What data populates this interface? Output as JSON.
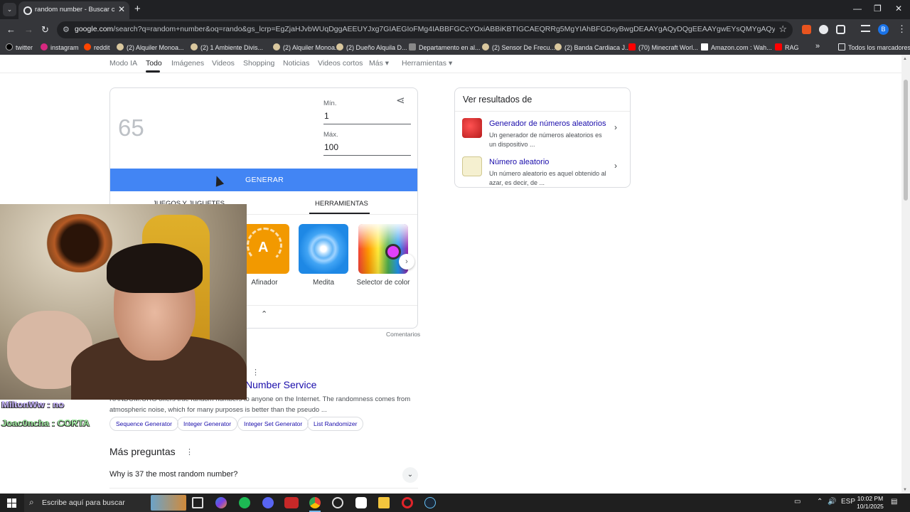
{
  "browser": {
    "tab_title": "random number - Buscar con Google",
    "url_host": "google.com",
    "url_rest": "/search?q=random+number&oq=rando&gs_lcrp=EgZjaHJvbWUqDggAEEUYJxg7GIAEGIoFMg4IABBFGCcYOxiABBiKBTIGCAEQRRg5MgYIAhBFGDsyBwgDEAAYgAQyDQgEEAAYgwEYsQMYgAQyBggFEEUYPTIGCAYQRRg9MgYIBxB...",
    "profile_letter": "B"
  },
  "bookmarks": [
    "twitter",
    "instagram",
    "reddit",
    "(2) Alquiler Monoa...",
    "(2) 1 Ambiente Divis...",
    "(2) Alquiler Monoa...",
    "(2) Dueño Alquila D...",
    "Departamento en al...",
    "(2) Sensor De Frecu...",
    "(2) Banda Cardiaca J...",
    "(70) Minecraft Worl...",
    "Amazon.com : Wah...",
    "RAG"
  ],
  "bookmarks_more": "»",
  "bookmarks_all": "Todos los marcadores",
  "search_tabs": [
    "Modo IA",
    "Todo",
    "Imágenes",
    "Videos",
    "Shopping",
    "Noticias",
    "Videos cortos",
    "Más",
    "Herramientas"
  ],
  "rng": {
    "result": "65",
    "min_label": "Mín.",
    "min_value": "1",
    "max_label": "Máx.",
    "max_value": "100",
    "generate_label": "GENERAR",
    "tab_games": "JUEGOS Y JUGUETES",
    "tab_tools": "HERRAMIENTAS",
    "tools": [
      "Afinador",
      "Medita",
      "Selector de color"
    ],
    "tool_tuner_letter": "A",
    "feedback": "Comentarios"
  },
  "side_panel": {
    "heading": "Ver resultados de",
    "items": [
      {
        "title": "Generador de números aleatorios",
        "desc": "Un generador de números aleatorios es un dispositivo ..."
      },
      {
        "title": "Número aleatorio",
        "desc": "Un número aleatorio es aquel obtenido al azar, es decir, de ..."
      }
    ]
  },
  "web_result": {
    "title": "Number Service",
    "snippet_1": "RANDOM.ORG offers true random numbers to anyone on the Internet. The randomness comes from",
    "snippet_2": "atmospheric noise, which for many purposes is better than the pseudo ...",
    "chips": [
      "Sequence Generator",
      "Integer Generator",
      "Integer Set Generator",
      "List Randomizer"
    ]
  },
  "paa": {
    "heading": "Más preguntas",
    "question": "Why is 37 the most random number?"
  },
  "stream_chat": [
    {
      "user": "MiltonWw",
      "msg": ": no"
    },
    {
      "user": "Joac0ncha",
      "msg": ": CORTA"
    }
  ],
  "taskbar": {
    "search_placeholder": "Escribe aquí para buscar",
    "lang": "ESP",
    "time": "10:02 PM",
    "date": "10/1/2025"
  }
}
